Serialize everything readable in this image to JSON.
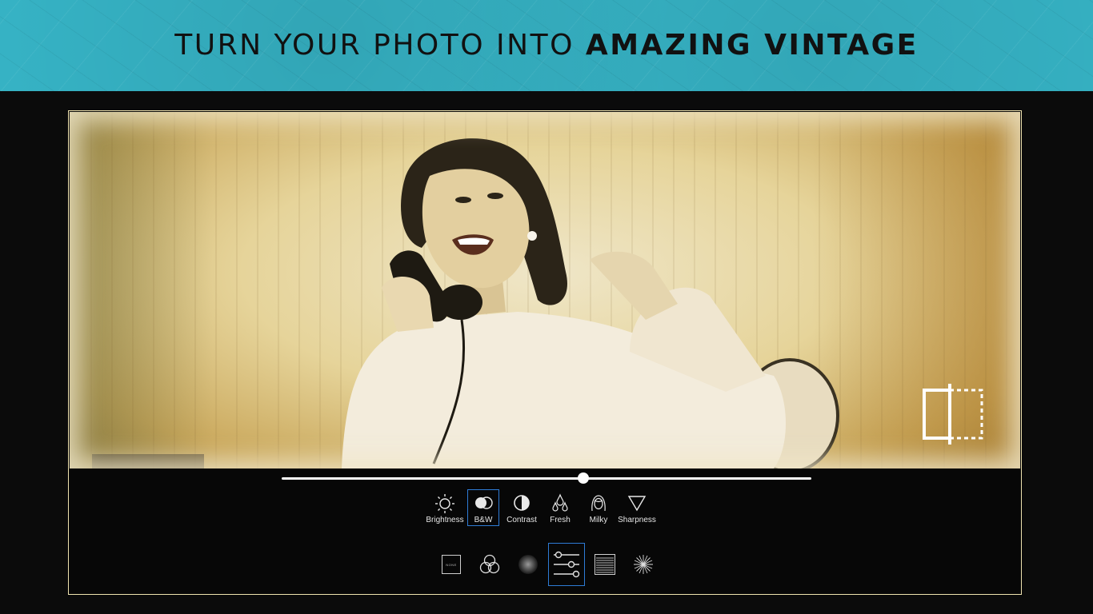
{
  "banner": {
    "title_regular": "TURN YOUR PHOTO INTO ",
    "title_bold": "AMAZING VINTAGE",
    "background_color": "#36b3c5"
  },
  "editor": {
    "frame_border_color": "#efe3b0",
    "slider": {
      "value_fraction": 0.57
    }
  },
  "adjust_tools": [
    {
      "icon": "sun-icon",
      "label": "Brightness",
      "selected": false
    },
    {
      "icon": "bw-circles-icon",
      "label": "B&W",
      "selected": true
    },
    {
      "icon": "half-circle-icon",
      "label": "Contrast",
      "selected": false
    },
    {
      "icon": "droplets-icon",
      "label": "Fresh",
      "selected": false
    },
    {
      "icon": "face-icon",
      "label": "Milky",
      "selected": false
    },
    {
      "icon": "triangle-icon",
      "label": "Sharpness",
      "selected": false
    }
  ],
  "bottom_toolbar": [
    {
      "icon": "none-icon",
      "text": "NONE",
      "selected": false
    },
    {
      "icon": "filters-circles-icon",
      "selected": false
    },
    {
      "icon": "vignette-icon",
      "selected": false
    },
    {
      "icon": "sliders-icon",
      "selected": true
    },
    {
      "icon": "texture-icon",
      "selected": false
    },
    {
      "icon": "light-burst-icon",
      "selected": false
    }
  ],
  "accent_color": "#2e7cd6"
}
